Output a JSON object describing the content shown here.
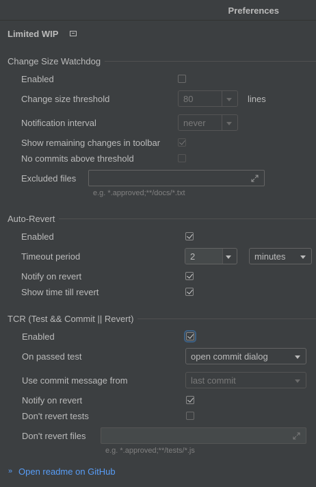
{
  "window": {
    "title": "Preferences"
  },
  "heading": {
    "title": "Limited WIP",
    "icon": "collapse-icon"
  },
  "watchdog": {
    "section_title": "Change Size Watchdog",
    "enabled_label": "Enabled",
    "enabled": false,
    "threshold_label": "Change size threshold",
    "threshold_value": "80",
    "threshold_unit": "lines",
    "interval_label": "Notification interval",
    "interval_value": "never",
    "show_remaining_label": "Show remaining changes in toolbar",
    "show_remaining": true,
    "no_commits_label": "No commits above threshold",
    "no_commits": false,
    "excluded_label": "Excluded files",
    "excluded_value": "",
    "excluded_hint": "e.g. *.approved;**/docs/*.txt"
  },
  "autorevert": {
    "section_title": "Auto-Revert",
    "enabled_label": "Enabled",
    "enabled": true,
    "timeout_label": "Timeout period",
    "timeout_value": "2",
    "timeout_unit": "minutes",
    "notify_label": "Notify on revert",
    "notify": true,
    "show_time_label": "Show time till revert",
    "show_time": true
  },
  "tcr": {
    "section_title": "TCR (Test && Commit || Revert)",
    "enabled_label": "Enabled",
    "enabled": true,
    "passed_label": "On passed test",
    "passed_value": "open commit dialog",
    "message_label": "Use commit message from",
    "message_value": "last commit",
    "notify_label": "Notify on revert",
    "notify": true,
    "dont_revert_tests_label": "Don't revert tests",
    "dont_revert_tests": false,
    "dont_revert_files_label": "Don't revert files",
    "dont_revert_files_value": "",
    "dont_revert_files_hint": "e.g. *.approved;**/tests/*.js"
  },
  "footer": {
    "link_label": "Open readme on GitHub",
    "chevron": "»"
  }
}
